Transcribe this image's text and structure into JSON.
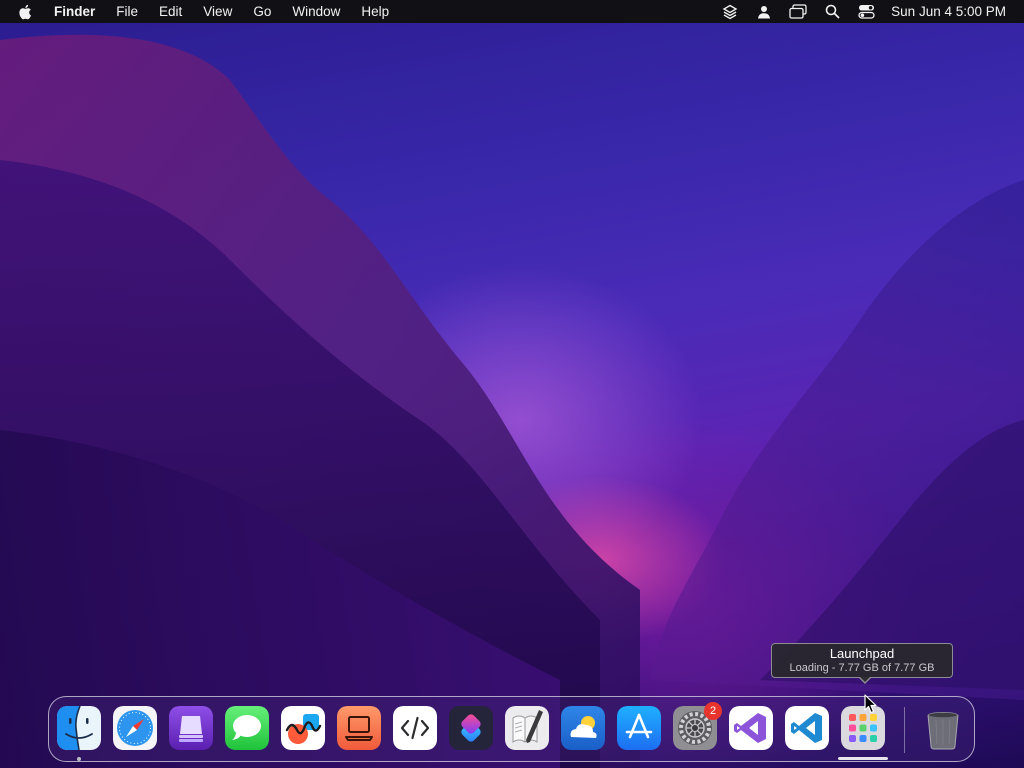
{
  "menubar": {
    "apple_icon": "apple-logo-icon",
    "app_name": "Finder",
    "menus": [
      "File",
      "Edit",
      "View",
      "Go",
      "Window",
      "Help"
    ],
    "status_icons": [
      "stack-layers-icon",
      "user-icon",
      "screen-mirroring-icon",
      "spotlight-search-icon",
      "control-center-icon"
    ],
    "clock": "Sun Jun 4  5:00 PM"
  },
  "tooltip": {
    "title": "Launchpad",
    "subtitle": "Loading - 7.77 GB of 7.77 GB"
  },
  "dock": {
    "apps": [
      {
        "name": "Finder",
        "icon": "finder-icon",
        "running": true
      },
      {
        "name": "Safari",
        "icon": "safari-icon",
        "running": false
      },
      {
        "name": "Apple Configurator",
        "icon": "configurator-icon",
        "running": false
      },
      {
        "name": "Messages",
        "icon": "messages-icon",
        "running": false
      },
      {
        "name": "Freeform",
        "icon": "freeform-icon",
        "running": false
      },
      {
        "name": "Presentation app",
        "icon": "laptop-app-icon",
        "running": false
      },
      {
        "name": "Code editor",
        "icon": "code-brackets-icon",
        "running": false
      },
      {
        "name": "Shortcuts",
        "icon": "shortcuts-icon",
        "running": false
      },
      {
        "name": "Script Editor",
        "icon": "script-editor-icon",
        "running": false
      },
      {
        "name": "Weather",
        "icon": "weather-icon",
        "running": false
      },
      {
        "name": "App Store",
        "icon": "app-store-icon",
        "running": false
      },
      {
        "name": "System Preferences",
        "icon": "system-preferences-icon",
        "running": false,
        "badge": "2"
      },
      {
        "name": "Visual Studio",
        "icon": "visual-studio-icon",
        "running": false
      },
      {
        "name": "Visual Studio Code",
        "icon": "vscode-icon",
        "running": false
      },
      {
        "name": "Launchpad",
        "icon": "launchpad-icon",
        "running": false
      },
      {
        "name": "Trash",
        "icon": "trash-icon",
        "running": false
      }
    ],
    "launchpad_progress": 1.0
  },
  "colors": {
    "menubar_bg": "#111014",
    "badge": "#e7352e",
    "wallpaper_deep": "#1e0a55",
    "wallpaper_glow": "#f050aa"
  }
}
